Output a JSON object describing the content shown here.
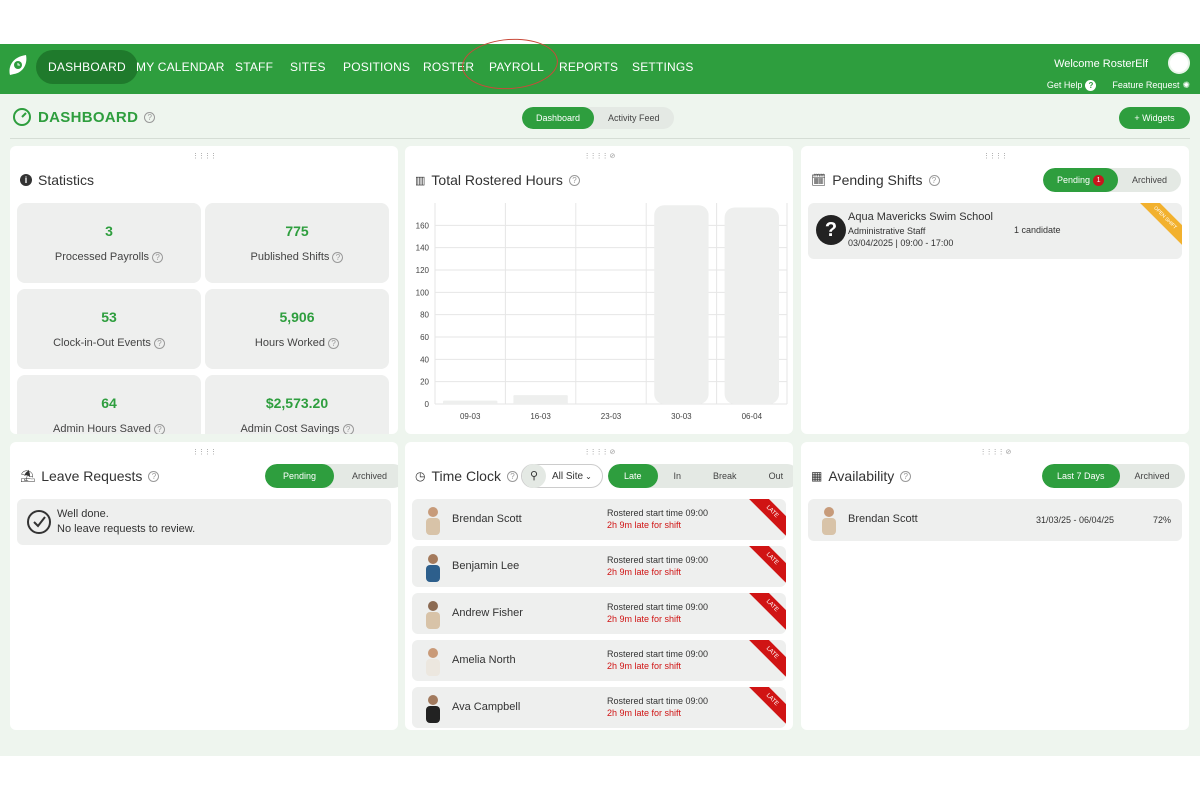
{
  "nav": {
    "items": [
      "DASHBOARD",
      "MY CALENDAR",
      "STAFF",
      "SITES",
      "POSITIONS",
      "ROSTER",
      "PAYROLL",
      "REPORTS",
      "SETTINGS"
    ],
    "welcome": "Welcome RosterElf",
    "get_help": "Get Help",
    "feature_request": "Feature Request"
  },
  "header": {
    "title": "DASHBOARD",
    "tabs": [
      "Dashboard",
      "Activity Feed"
    ],
    "widgets_button": "+ Widgets"
  },
  "statistics": {
    "title": "Statistics",
    "items": [
      {
        "value": "3",
        "label": "Processed Payrolls"
      },
      {
        "value": "775",
        "label": "Published Shifts"
      },
      {
        "value": "53",
        "label": "Clock-in-Out Events"
      },
      {
        "value": "5,906",
        "label": "Hours Worked"
      },
      {
        "value": "64",
        "label": "Admin Hours Saved"
      },
      {
        "value": "$2,573.20",
        "label": "Admin Cost Savings"
      }
    ]
  },
  "rostered_hours": {
    "title": "Total Rostered Hours"
  },
  "chart_data": {
    "type": "bar",
    "categories": [
      "09-03",
      "16-03",
      "23-03",
      "30-03",
      "06-04"
    ],
    "values": [
      3,
      8,
      0,
      178,
      176
    ],
    "ylim": [
      0,
      180
    ],
    "yticks": [
      0,
      20,
      40,
      60,
      80,
      100,
      120,
      140,
      160
    ],
    "grid": true,
    "bar_color": "#eeefee"
  },
  "pending_shifts": {
    "title": "Pending Shifts",
    "tabs": [
      "Pending",
      "Archived"
    ],
    "badge": "1",
    "card": {
      "company": "Aqua Mavericks Swim School",
      "role": "Administrative Staff",
      "time": "03/04/2025 | 09:00 - 17:00",
      "candidates": "1 candidate",
      "ribbon": "OPEN SHIFT"
    }
  },
  "leave_requests": {
    "title": "Leave Requests",
    "tabs": [
      "Pending",
      "Archived"
    ],
    "message_title": "Well done.",
    "message_body": "No leave requests to review."
  },
  "time_clock": {
    "title": "Time Clock",
    "site_filter": "All Site",
    "tabs": [
      "Late",
      "In",
      "Break",
      "Out"
    ],
    "rows": [
      {
        "name": "Brendan Scott",
        "start": "Rostered start time 09:00",
        "late": "2h 9m late for shift",
        "ribbon": "LATE"
      },
      {
        "name": "Benjamin Lee",
        "start": "Rostered start time 09:00",
        "late": "2h 9m late for shift",
        "ribbon": "LATE"
      },
      {
        "name": "Andrew Fisher",
        "start": "Rostered start time 09:00",
        "late": "2h 9m late for shift",
        "ribbon": "LATE"
      },
      {
        "name": "Amelia North",
        "start": "Rostered start time 09:00",
        "late": "2h 9m late for shift",
        "ribbon": "LATE"
      },
      {
        "name": "Ava Campbell",
        "start": "Rostered start time 09:00",
        "late": "2h 9m late for shift",
        "ribbon": "LATE"
      }
    ]
  },
  "availability": {
    "title": "Availability",
    "tabs": [
      "Last 7 Days",
      "Archived"
    ],
    "row": {
      "name": "Brendan Scott",
      "range": "31/03/25 - 06/04/25",
      "percent": "72%"
    }
  },
  "colors": {
    "brand_green": "#2e9e3e",
    "late_red": "#d01414",
    "ribbon_yellow": "#f2b12e"
  }
}
